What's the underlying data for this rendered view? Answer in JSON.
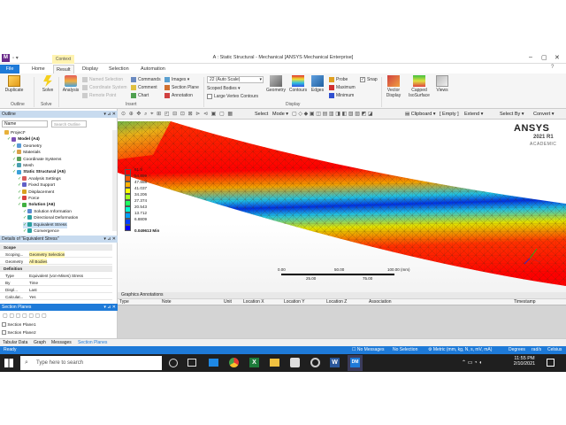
{
  "window": {
    "title": "A : Static Structural - Mechanical [ANSYS Mechanical Enterprise]",
    "context_tab": "Context"
  },
  "ribbon_tabs": [
    "File",
    "Home",
    "Result",
    "Display",
    "Selection",
    "Automation"
  ],
  "quick_launch_placeholder": "Quick Launch",
  "ribbon": {
    "outline_group": {
      "duplicate": "Duplicate",
      "label": "Outline"
    },
    "solve_group": {
      "solve": "Solve",
      "label": "Solve"
    },
    "analysis": "Analysis",
    "insert_items": [
      "Named Selection",
      "Coordinate System",
      "Remote Point",
      "Commands",
      "Comment",
      "Chart",
      "Images",
      "Section Plane",
      "Annotation"
    ],
    "insert_label": "Insert",
    "scale_value": "22 (Auto Scale)",
    "scoped_bodies": "Scoped Bodies",
    "large_vertex": "Large Vertex Contours",
    "display_buttons": [
      "Geometry",
      "Contours",
      "Edges"
    ],
    "probe_items": [
      "Probe",
      "Maximum",
      "Minimum"
    ],
    "snap": "Snap",
    "display_label": "Display",
    "vector_display": "Vector Display",
    "capped_isosurface": "Capped IsoSurface",
    "views": "Views"
  },
  "outline": {
    "header": "Outline",
    "name_col": "Name",
    "search_placeholder": "Search Outline",
    "nodes": [
      {
        "label": "Project*",
        "color": "#e8b13a"
      },
      {
        "label": "Model (A4)",
        "color": "#7a4fb5"
      },
      {
        "label": "Geometry",
        "color": "#5a9bd6"
      },
      {
        "label": "Materials",
        "color": "#d8a24a"
      },
      {
        "label": "Coordinate Systems",
        "color": "#5aa05a"
      },
      {
        "label": "Mesh",
        "color": "#4aa0b0"
      },
      {
        "label": "Static Structural (A5)",
        "color": "#3aa0d8"
      },
      {
        "label": "Analysis Settings",
        "color": "#d85a5a"
      },
      {
        "label": "Fixed Support",
        "color": "#6060c8"
      },
      {
        "label": "Displacement",
        "color": "#d8a020"
      },
      {
        "label": "Force",
        "color": "#d84040"
      },
      {
        "label": "Solution (A6)",
        "color": "#40b040"
      },
      {
        "label": "Solution Information",
        "color": "#5a8ad0"
      },
      {
        "label": "Directional Deformation",
        "color": "#2aa0a0"
      },
      {
        "label": "Equivalent Stress",
        "color": "#2aa0a0"
      },
      {
        "label": "Convergence",
        "color": "#2aa0a0"
      }
    ]
  },
  "details": {
    "header": "Details of \"Equivalent Stress\"",
    "rows": [
      {
        "k": "Scope",
        "v": "",
        "cat": true
      },
      {
        "k": "Scoping...",
        "v": "Geometry Selection"
      },
      {
        "k": "Geometry",
        "v": "All Bodies"
      },
      {
        "k": "Definition",
        "v": "",
        "cat": true
      },
      {
        "k": "Type",
        "v": "Equivalent (von-Mises) Stress"
      },
      {
        "k": "By",
        "v": "Time"
      },
      {
        "k": "Displ...",
        "v": "Last"
      },
      {
        "k": "Calculat...",
        "v": "Yes"
      }
    ]
  },
  "section_planes": {
    "header": "Section Planes",
    "items": [
      "Section Plane1",
      "Section Plane2"
    ]
  },
  "viewport": {
    "toolbar": {
      "select": "Select",
      "mode": "Mode",
      "clipboard": "Clipboard",
      "clipboard_state": "[ Empty ]",
      "extend": "Extend",
      "select_by": "Select By",
      "convert": "Convert"
    },
    "brand": "ANSYS",
    "version": "2021 R1",
    "edition": "ACADEMIC",
    "legend_values": [
      "61.5",
      "54.699",
      "47.868",
      "41.037",
      "34.206",
      "27.374",
      "20.543",
      "13.712",
      "6.8809"
    ],
    "legend_min": "0.049613 Min",
    "legend_colors": [
      "#ff0000",
      "#ff5a00",
      "#ffb000",
      "#ffff00",
      "#a0ff20",
      "#20ff60",
      "#00ffd0",
      "#00a0ff",
      "#0040ff",
      "#0000ff"
    ],
    "scale_top": [
      "0.00",
      "50.00",
      "100.00 (mm)"
    ],
    "scale_bottom": [
      "25.00",
      "75.00"
    ]
  },
  "annotations": {
    "header": "Graphics Annotations",
    "columns": [
      "Type",
      "Note",
      "Unit",
      "Location X",
      "Location Y",
      "Location Z",
      "Association",
      "Timestamp"
    ]
  },
  "bottom_tabs": [
    "Tabular Data",
    "Graph",
    "Messages",
    "Section Planes"
  ],
  "status": {
    "left": "Ready",
    "messages": "No Messages",
    "selection": "No Selection",
    "units": "Metric (mm, kg, N, s, mV, mA)",
    "angle": "Degrees",
    "angular_velocity": "rad/s",
    "temperature": "Celsius"
  },
  "taskbar": {
    "search_placeholder": "Type here to search",
    "time": "11:55 PM",
    "date": "2/10/2021"
  }
}
